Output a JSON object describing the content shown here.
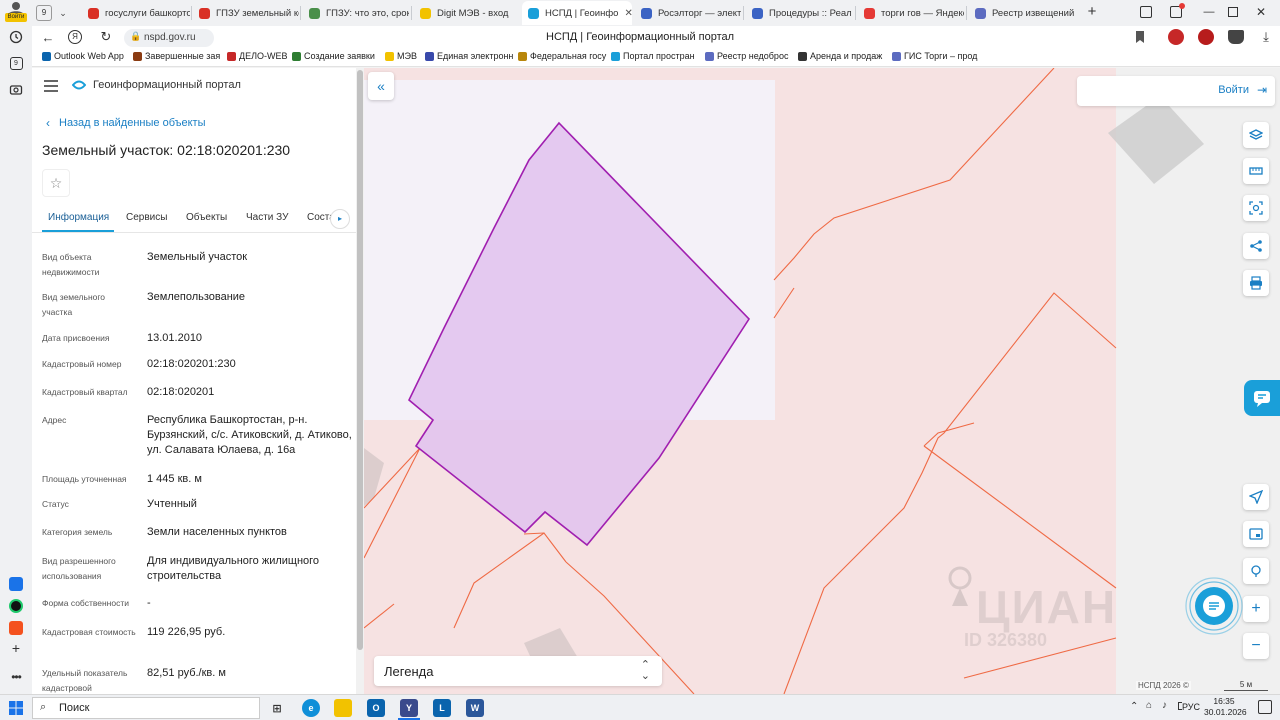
{
  "browser": {
    "profile_badge": "Войти",
    "tab_count": "9",
    "tabs": [
      {
        "label": "госуслуги башкорто",
        "color": "#d93025"
      },
      {
        "label": "ГПЗУ земельный ко",
        "color": "#d93025"
      },
      {
        "label": "ГПЗУ: что это, срок",
        "color": "#4a8f4a"
      },
      {
        "label": "Digit МЭВ - вход",
        "color": "#f2c200"
      },
      {
        "label": "НСПД | Геоинфо",
        "color": "#1a9fd9"
      },
      {
        "label": "Росэлторг — электр",
        "color": "#3b63c4"
      },
      {
        "label": "Процедуры :: Реали",
        "color": "#3b63c4"
      },
      {
        "label": "торги гов — Яндекс",
        "color": "#e53935"
      },
      {
        "label": "Реестр извещений",
        "color": "#5c6bc0"
      }
    ],
    "address": "nspd.gov.ru",
    "page_title": "НСПД | Геоинформационный портал",
    "bookmarks": [
      {
        "label": "Outlook Web App",
        "color": "#0a64ad"
      },
      {
        "label": "Завершенные зая",
        "color": "#8a3b12"
      },
      {
        "label": "ДЕЛО-WEB",
        "color": "#c62828"
      },
      {
        "label": "Создание заявки",
        "color": "#2e7d32"
      },
      {
        "label": "МЭВ",
        "color": "#f2c200"
      },
      {
        "label": "Единая электронн",
        "color": "#3949ab"
      },
      {
        "label": "Федеральная госу",
        "color": "#b8860b"
      },
      {
        "label": "Портал простран",
        "color": "#1a9fd9"
      },
      {
        "label": "Реестр недоброс",
        "color": "#5c6bc0"
      },
      {
        "label": "Аренда и продаж",
        "color": "#333333"
      },
      {
        "label": "ГИС Торги – прод",
        "color": "#5c6bc0"
      }
    ]
  },
  "portal": {
    "title": "Геоинформационный портал",
    "back_link": "Назад в найденные объекты",
    "object_title": "Земельный участок: 02:18:020201:230",
    "tabs": [
      "Информация",
      "Сервисы",
      "Объекты",
      "Части ЗУ",
      "Соста"
    ],
    "active_tab": "Информация",
    "fields": [
      {
        "label": "Вид объекта недвижимости",
        "value": "Земельный участок"
      },
      {
        "label": "Вид земельного участка",
        "value": "Землепользование"
      },
      {
        "label": "Дата присвоения",
        "value": "13.01.2010"
      },
      {
        "label": "Кадастровый номер",
        "value": "02:18:020201:230"
      },
      {
        "label": "Кадастровый квартал",
        "value": "02:18:020201"
      },
      {
        "label": "Адрес",
        "value": "Республика Башкортостан, р-н. Бурзянский, с/с. Атиковский, д. Атиково, ул. Салавата Юлаева, д. 16а"
      },
      {
        "label": "Площадь уточненная",
        "value": "1 445 кв. м"
      },
      {
        "label": "Статус",
        "value": "Учтенный"
      },
      {
        "label": "Категория земель",
        "value": "Земли населенных пунктов"
      },
      {
        "label": "Вид разрешенного использования",
        "value": "Для индивидуального жилищного строительства"
      },
      {
        "label": "Форма собственности",
        "value": "-"
      },
      {
        "label": "Кадастровая стоимость",
        "value": "119 226,95 руб."
      },
      {
        "label": "Удельный показатель кадастровой",
        "value": "82,51 руб./кв. м"
      }
    ]
  },
  "map": {
    "login_label": "Войти",
    "legend_label": "Легенда",
    "attribution": "НСПД 2026 ©",
    "scale": "5 м",
    "watermark": "ЦИАН",
    "watermark_id": "ID 326380",
    "parcel_fill": "#e2c4ee",
    "parcel_stroke": "#a01fb0",
    "boundary_color": "#ef6a45",
    "accent": "#1a9fd9"
  },
  "taskbar": {
    "search_label": "Поиск",
    "language": "РУС",
    "time": "16:35",
    "date": "30.01.2026"
  }
}
